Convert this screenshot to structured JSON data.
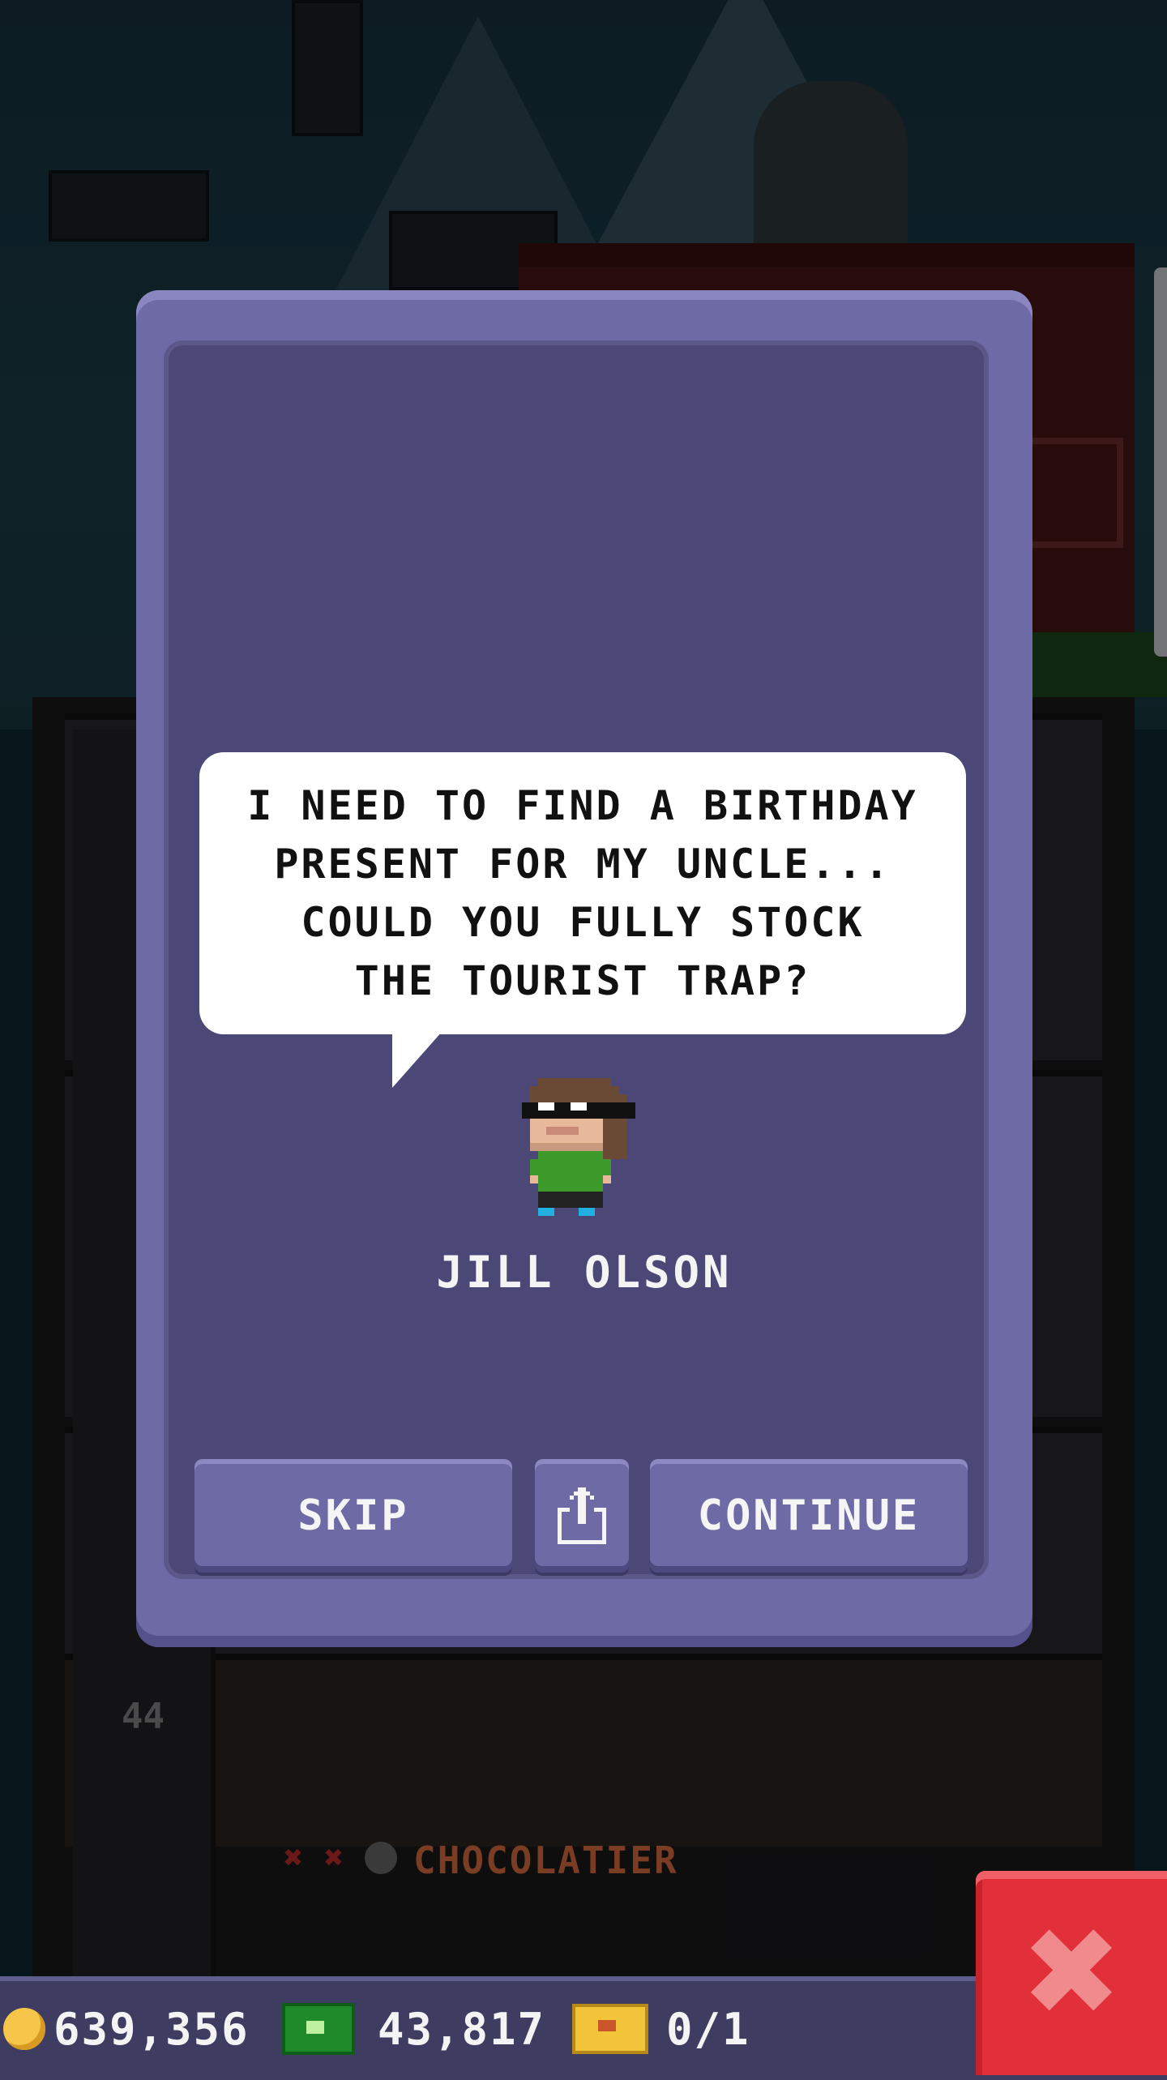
{
  "dialog": {
    "speech": "I NEED TO FIND A BIRTHDAY\nPRESENT FOR MY UNCLE...\nCOULD YOU FULLY STOCK\nTHE TOURIST TRAP?",
    "character_name": "JILL OLSON",
    "buttons": {
      "skip": "SKIP",
      "share_icon": "share-icon",
      "continue": "CONTINUE"
    }
  },
  "background": {
    "floor_label": "CHOCOLATIER",
    "floor_number": "44"
  },
  "status_bar": {
    "coins": "639,356",
    "bux": "43,817",
    "tickets": "0/1"
  },
  "close_icon": "close-icon",
  "colors": {
    "dialog_frame": "#6e6aa6",
    "dialog_inner": "#4b4877",
    "close_button": "#e1303a",
    "bottom_bar": "#3e3d61"
  }
}
